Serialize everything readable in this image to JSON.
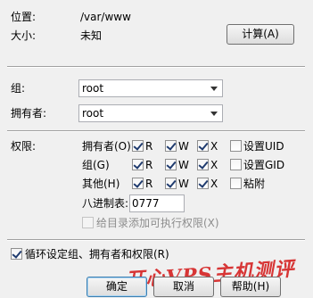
{
  "info": {
    "location_label": "位置:",
    "location_value": "/var/www",
    "size_label": "大小:",
    "size_value": "未知",
    "compute_button": "计算(A)"
  },
  "ownership": {
    "group_label": "组:",
    "group_value": "root",
    "owner_label": "拥有者:",
    "owner_value": "root"
  },
  "permissions": {
    "label": "权限:",
    "rows": [
      {
        "label": "拥有者(O)",
        "r": {
          "text": "R",
          "checked": true
        },
        "w": {
          "text": "W",
          "checked": true
        },
        "x": {
          "text": "X",
          "checked": true
        },
        "extra": {
          "text": "设置UID",
          "checked": false
        }
      },
      {
        "label": "组(G)",
        "r": {
          "text": "R",
          "checked": true
        },
        "w": {
          "text": "W",
          "checked": true
        },
        "x": {
          "text": "X",
          "checked": true
        },
        "extra": {
          "text": "设置GID",
          "checked": false
        }
      },
      {
        "label": "其他(H)",
        "r": {
          "text": "R",
          "checked": true
        },
        "w": {
          "text": "W",
          "checked": true
        },
        "x": {
          "text": "X",
          "checked": true
        },
        "extra": {
          "text": "粘附",
          "checked": false
        }
      }
    ],
    "octal_label": "八进制表:",
    "octal_value": "0777",
    "subdir_exec_label": "给目录添加可执行权限(X)",
    "subdir_exec_checked": false
  },
  "recursive": {
    "label": "循环设定组、拥有者和权限(R)",
    "checked": true
  },
  "buttons": {
    "ok": "确定",
    "cancel": "取消",
    "help": "帮助(H)"
  },
  "watermark": "开心VPS主机测评"
}
